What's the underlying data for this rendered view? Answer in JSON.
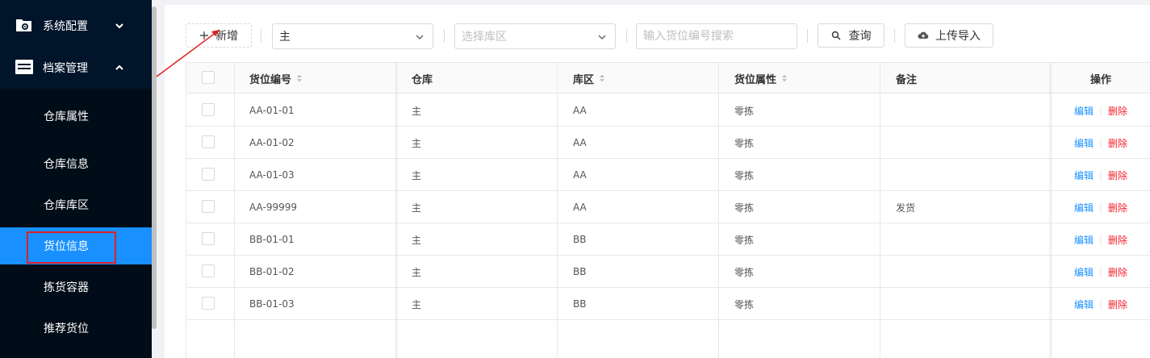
{
  "sidebar": {
    "groups": [
      {
        "label": "系统配置",
        "icon": "folder-gear-icon",
        "expanded": false
      },
      {
        "label": "档案管理",
        "icon": "archive-box-icon",
        "expanded": true
      }
    ],
    "items": [
      {
        "label": "仓库属性",
        "active": false
      },
      {
        "label": "仓库信息",
        "active": false
      },
      {
        "label": "仓库库区",
        "active": false
      },
      {
        "label": "货位信息",
        "active": true
      },
      {
        "label": "拣货容器",
        "active": false
      },
      {
        "label": "推荐货位",
        "active": false
      }
    ]
  },
  "toolbar": {
    "add_label": "新增",
    "warehouse_select_value": "主",
    "zone_select_placeholder": "选择库区",
    "search_placeholder": "输入货位编号搜索",
    "query_label": "查询",
    "upload_label": "上传导入"
  },
  "table": {
    "headers": {
      "location_code": "货位编号",
      "warehouse": "仓库",
      "zone": "库区",
      "attribute": "货位属性",
      "remark": "备注",
      "actions": "操作"
    },
    "rows": [
      {
        "location_code": "AA-01-01",
        "warehouse": "主",
        "zone": "AA",
        "attribute": "零拣",
        "remark": ""
      },
      {
        "location_code": "AA-01-02",
        "warehouse": "主",
        "zone": "AA",
        "attribute": "零拣",
        "remark": ""
      },
      {
        "location_code": "AA-01-03",
        "warehouse": "主",
        "zone": "AA",
        "attribute": "零拣",
        "remark": ""
      },
      {
        "location_code": "AA-99999",
        "warehouse": "主",
        "zone": "AA",
        "attribute": "零拣",
        "remark": "发货"
      },
      {
        "location_code": "BB-01-01",
        "warehouse": "主",
        "zone": "BB",
        "attribute": "零拣",
        "remark": ""
      },
      {
        "location_code": "BB-01-02",
        "warehouse": "主",
        "zone": "BB",
        "attribute": "零拣",
        "remark": ""
      },
      {
        "location_code": "BB-01-03",
        "warehouse": "主",
        "zone": "BB",
        "attribute": "零拣",
        "remark": ""
      }
    ],
    "edit_label": "编辑",
    "delete_label": "删除",
    "divider": "|"
  },
  "colors": {
    "sidebar_bg": "#00142a",
    "active_bg": "#1890ff",
    "edit_link": "#1890ff",
    "delete_link": "#f5222d",
    "annotation_red": "#e02020"
  }
}
